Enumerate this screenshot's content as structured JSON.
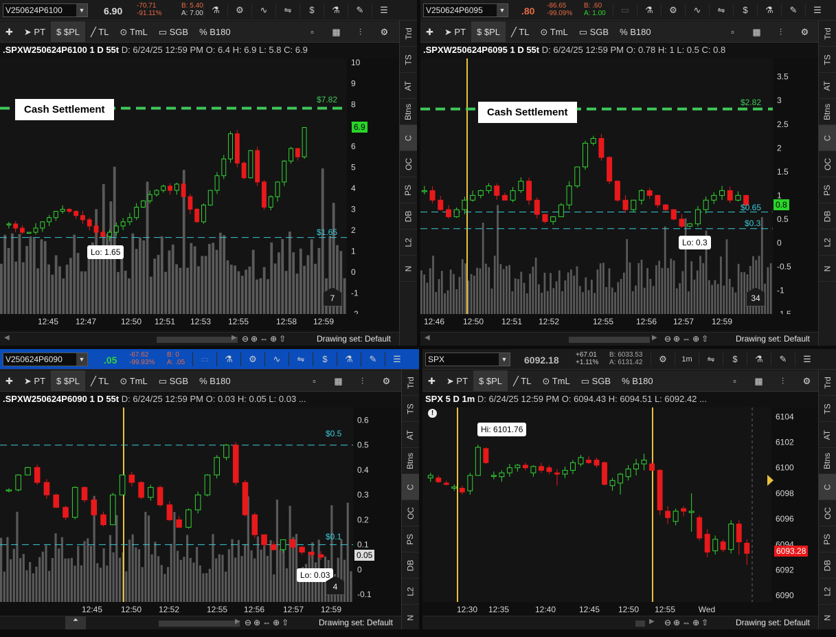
{
  "colors": {
    "up": "#33d633",
    "down": "#e8191b",
    "cash_line": "#3ec85a",
    "cyan": "#39c9d8",
    "volume": "#5a5a5a",
    "vline": "#e9c33b"
  },
  "toolbar": {
    "items": [
      "PT",
      "$PL",
      "TL",
      "TmL",
      "SGB",
      "B180"
    ]
  },
  "side_tabs": [
    "Trd",
    "TS",
    "AT",
    "Btns",
    "C",
    "OC",
    "PS",
    "DB",
    "L2",
    "N"
  ],
  "drawing_set": "Drawing set: Default",
  "panels": [
    {
      "symbol": "V250624P6100",
      "last": "6.90",
      "chg": "-70.71",
      "chg_pct": "-91.11%",
      "bid": "B: 5.40",
      "ask": "A: 7.00",
      "info": {
        "sym": ".SPXW250624P6100 1 D 55t",
        "d": "D: 6/24/25 12:59 PM",
        "o": "O: 6.4",
        "h": "H: 6.9",
        "l": "L: 5.8",
        "c": "C: 6.9"
      },
      "y_ticks": [
        "10",
        "9",
        "8",
        "7",
        "6",
        "5",
        "4",
        "3",
        "2",
        "1",
        "0",
        "-1",
        "-2"
      ],
      "x_ticks": [
        "12:45",
        "12:47",
        "12:50",
        "12:51",
        "12:53",
        "12:55",
        "12:58",
        "12:59"
      ],
      "cash_label": "Cash Settlement",
      "cash_price": "$7.82",
      "cyan_price": "$1.65",
      "price_tag": "6.9",
      "lo_label": "Lo: 1.65",
      "badge": "7"
    },
    {
      "symbol": "V250624P6095",
      "last": ".80",
      "chg": "-86.65",
      "chg_pct": "-99.09%",
      "bid": "B: .60",
      "ask": "A: 1.00",
      "info": {
        "sym": ".SPXW250624P6095 1 D 55t",
        "d": "D: 6/24/25 12:59 PM",
        "o": "O: 0.78",
        "h": "H: 1",
        "l": "L: 0.5",
        "c": "C: 0.8"
      },
      "y_ticks": [
        "3.5",
        "3",
        "2.5",
        "2",
        "1.5",
        "1",
        "0.5",
        "0",
        "-0.5",
        "-1",
        "-1.5"
      ],
      "x_ticks": [
        "12:46",
        "12:50",
        "12:51",
        "12:52",
        "12:55",
        "12:56",
        "12:57",
        "12:59"
      ],
      "cash_label": "Cash Settlement",
      "cash_price": "$2.82",
      "cyan_price_a": "$0.65",
      "cyan_price_b": "$0.3",
      "price_tag": "0.8",
      "lo_label": "Lo: 0.3",
      "badge": "34"
    },
    {
      "symbol": "V250624P6090",
      "last": ".05",
      "chg": "-67.62",
      "chg_pct": "-99.93%",
      "bid": "B: 0",
      "ask": "A: .05",
      "info": {
        "sym": ".SPXW250624P6090 1 D 55t",
        "d": "D: 6/24/25 12:59 PM",
        "o": "O: 0.03",
        "h": "H: 0.05",
        "l": "L: 0.03",
        "more": "..."
      },
      "y_ticks": [
        "0.6",
        "0.5",
        "0.4",
        "0.3",
        "0.2",
        "0.1",
        "0",
        "-0.1"
      ],
      "x_ticks": [
        "12:45",
        "12:50",
        "12:52",
        "12:55",
        "12:56",
        "12:57",
        "12:59"
      ],
      "cyan_price_a": "$0.5",
      "cyan_price_b": "$0.1",
      "price_tag": "0.05",
      "lo_label": "Lo: 0.03",
      "badge": "4"
    },
    {
      "symbol": "SPX",
      "last": "6092.18",
      "chg": "+67.01",
      "chg_pct": "+1.11%",
      "bid": "B: 6033.53",
      "ask": "A: 6131.42",
      "info": {
        "sym": "SPX 5 D 1m",
        "d": "D: 6/24/25 12:59 PM",
        "o": "O: 6094.43",
        "h": "H: 6094.51",
        "l": "L: 6092.42",
        "more": "..."
      },
      "y_ticks": [
        "6104",
        "6102",
        "6100",
        "6098",
        "6096",
        "6094",
        "6092",
        "6090"
      ],
      "x_ticks": [
        "12:30",
        "12:35",
        "12:40",
        "12:45",
        "12:50",
        "12:55",
        "Wed"
      ],
      "hi_label": "Hi: 6101.76",
      "price_tag": "6093.28",
      "interval": "1m"
    }
  ],
  "chart_data": [
    {
      "type": "candlestick",
      "title": ".SPXW250624P6100 1 D 55t",
      "ylim": [
        -2,
        10
      ],
      "levels": [
        7.82,
        1.65
      ],
      "last": 6.9,
      "low": 1.65,
      "close": [
        2.3,
        2.1,
        1.9,
        1.9,
        2.1,
        2.4,
        2.6,
        2.9,
        3.0,
        2.9,
        2.7,
        2.5,
        2.2,
        1.9,
        1.7,
        1.9,
        2.2,
        2.4,
        2.6,
        3.1,
        3.4,
        3.7,
        3.9,
        4.1,
        3.9,
        4.2,
        3.6,
        3.0,
        2.4,
        3.2,
        3.9,
        4.6,
        5.4,
        6.6,
        5.2,
        4.5,
        5.8,
        4.3,
        3.1,
        3.6,
        4.3,
        5.3,
        5.9,
        5.5,
        6.9
      ]
    },
    {
      "type": "candlestick",
      "title": ".SPXW250624P6095 1 D 55t",
      "ylim": [
        -1.5,
        3.8
      ],
      "levels": [
        2.82,
        0.65,
        0.3
      ],
      "last": 0.8,
      "low": 0.3,
      "close": [
        1.1,
        0.9,
        0.7,
        0.55,
        0.7,
        0.9,
        1.0,
        1.1,
        1.2,
        1.0,
        0.9,
        1.1,
        1.3,
        0.9,
        0.6,
        0.45,
        0.55,
        0.8,
        1.2,
        1.6,
        2.1,
        2.2,
        1.8,
        1.3,
        0.9,
        0.7,
        0.9,
        1.1,
        1.0,
        0.8,
        0.7,
        0.5,
        0.35,
        0.4,
        0.7,
        0.9,
        1.0,
        1.1,
        0.9,
        1.0,
        0.8
      ]
    },
    {
      "type": "candlestick",
      "title": ".SPXW250624P6090 1 D 55t",
      "ylim": [
        -0.13,
        0.64
      ],
      "levels": [
        0.5,
        0.1
      ],
      "last": 0.05,
      "low": 0.03,
      "close": [
        0.32,
        0.38,
        0.41,
        0.35,
        0.3,
        0.25,
        0.21,
        0.33,
        0.28,
        0.22,
        0.18,
        0.3,
        0.38,
        0.35,
        0.29,
        0.33,
        0.26,
        0.2,
        0.17,
        0.24,
        0.3,
        0.38,
        0.45,
        0.5,
        0.35,
        0.22,
        0.14,
        0.1,
        0.08,
        0.12,
        0.09,
        0.07,
        0.06,
        0.05
      ]
    },
    {
      "type": "candlestick",
      "title": "SPX 5 D 1m",
      "ylim": [
        6089.5,
        6104.5
      ],
      "last": 6093.28,
      "high": 6101.76,
      "candles": [
        [
          6099.2,
          6099.6,
          6098.9,
          6099.4
        ],
        [
          6099.2,
          6099.4,
          6098.8,
          6098.9
        ],
        [
          6098.8,
          6099.0,
          6098.6,
          6098.7
        ],
        [
          6098.4,
          6098.7,
          6098.2,
          6098.5
        ],
        [
          6098.4,
          6098.6,
          6097.9,
          6098.1
        ],
        [
          6098.2,
          6099.6,
          6097.9,
          6099.4
        ],
        [
          6099.4,
          6101.8,
          6099.4,
          6101.6
        ],
        [
          6101.5,
          6101.6,
          6100.3,
          6100.4
        ],
        [
          6099.4,
          6099.7,
          6099.1,
          6099.4
        ],
        [
          6099.3,
          6099.8,
          6098.9,
          6099.6
        ],
        [
          6099.6,
          6100.3,
          6099.3,
          6100.0
        ],
        [
          6100.0,
          6100.3,
          6099.7,
          6100.2
        ],
        [
          6100.2,
          6100.4,
          6099.8,
          6100.0
        ],
        [
          6099.6,
          6100.2,
          6099.3,
          6100.1
        ],
        [
          6100.1,
          6100.4,
          6099.6,
          6099.8
        ],
        [
          6100.0,
          6100.2,
          6099.5,
          6099.7
        ],
        [
          6099.6,
          6099.9,
          6098.6,
          6099.5
        ],
        [
          6099.5,
          6100.1,
          6099.2,
          6099.8
        ],
        [
          6099.8,
          6100.6,
          6099.5,
          6100.4
        ],
        [
          6100.3,
          6101.0,
          6100.1,
          6100.8
        ],
        [
          6100.6,
          6100.9,
          6100.3,
          6100.4
        ],
        [
          6100.6,
          6100.8,
          6100.0,
          6100.2
        ],
        [
          6100.4,
          6100.5,
          6098.6,
          6098.7
        ],
        [
          6098.6,
          6099.2,
          6098.2,
          6099.0
        ],
        [
          6098.8,
          6099.6,
          6097.9,
          6099.5
        ],
        [
          6099.3,
          6100.2,
          6099.0,
          6099.9
        ],
        [
          6099.9,
          6100.7,
          6099.4,
          6100.3
        ],
        [
          6100.3,
          6101.1,
          6099.8,
          6100.6
        ],
        [
          6100.3,
          6100.5,
          6099.7,
          6099.8
        ],
        [
          6099.8,
          6099.9,
          6096.3,
          6096.7
        ],
        [
          6096.6,
          6097.0,
          6095.6,
          6096.1
        ],
        [
          6095.8,
          6096.8,
          6095.5,
          6096.6
        ],
        [
          6096.8,
          6097.0,
          6096.2,
          6096.6
        ],
        [
          6096.5,
          6098.0,
          6095.0,
          6096.6
        ],
        [
          6096.1,
          6096.3,
          6094.3,
          6094.5
        ],
        [
          6094.8,
          6095.2,
          6093.0,
          6093.4
        ],
        [
          6093.5,
          6094.7,
          6093.2,
          6094.4
        ],
        [
          6094.2,
          6094.4,
          6093.4,
          6093.6
        ],
        [
          6093.6,
          6095.9,
          6093.3,
          6095.6
        ],
        [
          6095.6,
          6095.9,
          6093.2,
          6094.2
        ],
        [
          6094.1,
          6094.4,
          6092.4,
          6093.3
        ]
      ]
    }
  ]
}
